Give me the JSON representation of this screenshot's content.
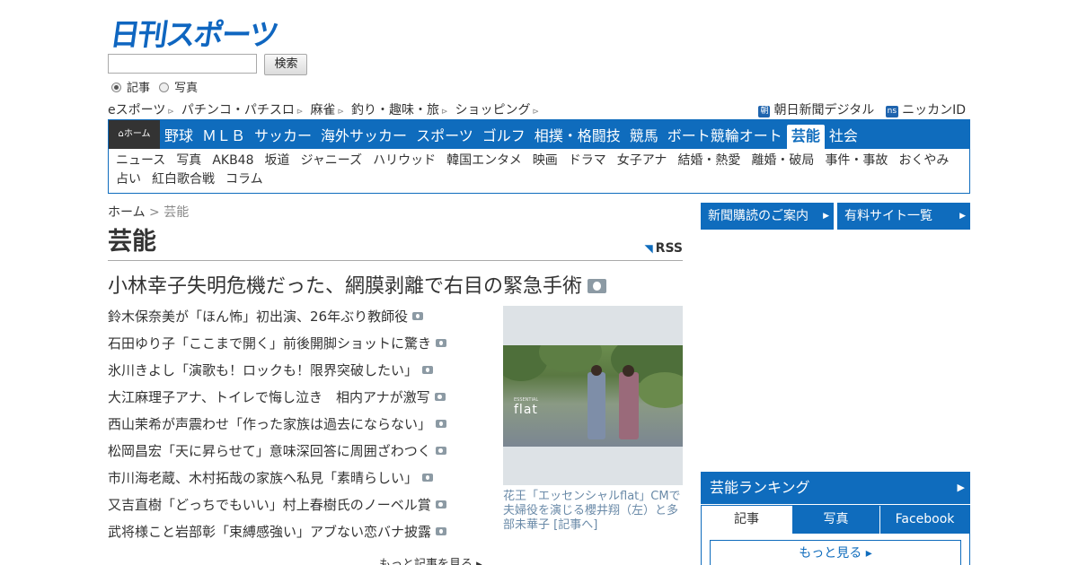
{
  "header": {
    "logo": "日刊スポーツ",
    "search_placeholder": "",
    "search_button": "検索",
    "radio_article": "記事",
    "radio_photo": "写真"
  },
  "subnav": {
    "left": [
      "eスポーツ",
      "パチンコ・パチスロ",
      "麻雀",
      "釣り・趣味・旅",
      "ショッピング"
    ],
    "arrow": "⊳",
    "asahi_badge": "朝",
    "asahi": "朝日新聞デジタル",
    "nikkan_badge": "ns",
    "nikkan": "ニッカンID"
  },
  "mainnav": {
    "home": "ホーム",
    "items": [
      "野球",
      "ＭＬＢ",
      "サッカー",
      "海外サッカー",
      "スポーツ",
      "ゴルフ",
      "相撲・格闘技",
      "競馬",
      "ボート競輪オート",
      "芸能",
      "社会"
    ],
    "active": "芸能",
    "genres": [
      "ニュース",
      "写真",
      "AKB48",
      "坂道",
      "ジャニーズ",
      "ハリウッド",
      "韓国エンタメ",
      "映画",
      "ドラマ",
      "女子アナ",
      "結婚・熱愛",
      "離婚・破局",
      "事件・事故",
      "おくやみ",
      "占い",
      "紅白歌合戦",
      "コラム"
    ]
  },
  "breadcrumb": {
    "home": "ホーム",
    "sep": " > ",
    "current": "芸能"
  },
  "page_title": "芸能",
  "rss": "RSS",
  "lead_headline": "小林幸子失明危機だった、網膜剥離で右目の緊急手術",
  "headlines": [
    "鈴木保奈美が「ほん怖」初出演、26年ぶり教師役",
    "石田ゆり子「ここまで開く」前後開脚ショットに驚き",
    "氷川きよし「演歌も！ロックも！限界突破したい」",
    "大江麻理子アナ、トイレで悔し泣き　相内アナが激写",
    "西山茉希が声震わせ「作った家族は過去にならない」",
    "松岡昌宏「天に昇らせて」意味深回答に周囲ざわつく",
    "市川海老蔵、木村拓哉の家族へ私見「素晴らしい」",
    "又吉直樹「どっちでもいい」村上春樹氏のノーベル賞",
    "武将様こと岩部彰「束縛感強い」アブない恋バナ披露"
  ],
  "more_articles": "もっと記事を見る",
  "photo": {
    "title_text": "flat",
    "caption": "花王「エッセンシャルflat」CMで夫婦役を演じる櫻井翔（左）と多部未華子 [記事へ]"
  },
  "right": {
    "btn_subscribe": "新聞購読のご案内",
    "btn_paid": "有料サイト一覧",
    "ranking_title": "芸能ランキング",
    "tabs": [
      "記事",
      "写真",
      "Facebook"
    ],
    "more": "もっと見る"
  },
  "colors": {
    "brand": "#0f6cbd",
    "logo": "#0f66c0"
  }
}
